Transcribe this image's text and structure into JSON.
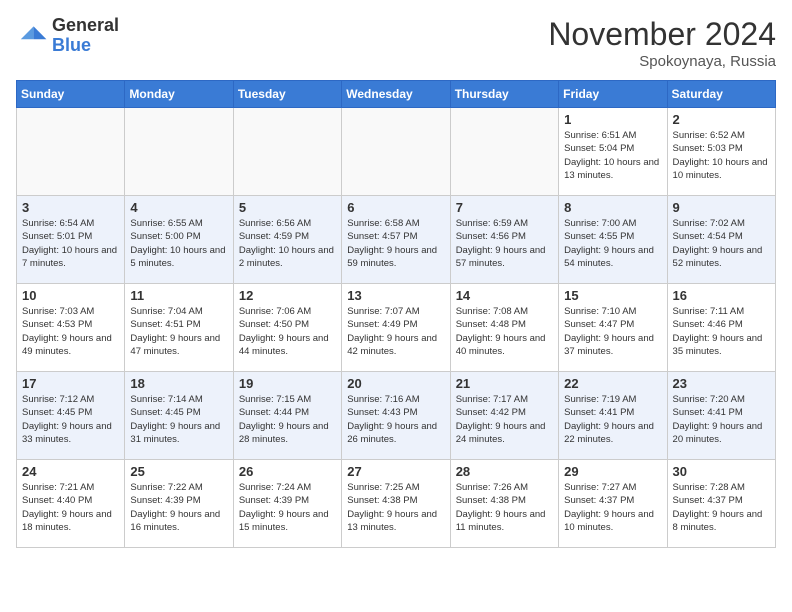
{
  "header": {
    "logo": {
      "line1": "General",
      "line2": "Blue"
    },
    "title": "November 2024",
    "subtitle": "Spokoynaya, Russia"
  },
  "weekdays": [
    "Sunday",
    "Monday",
    "Tuesday",
    "Wednesday",
    "Thursday",
    "Friday",
    "Saturday"
  ],
  "weeks": [
    [
      {
        "day": "",
        "info": ""
      },
      {
        "day": "",
        "info": ""
      },
      {
        "day": "",
        "info": ""
      },
      {
        "day": "",
        "info": ""
      },
      {
        "day": "",
        "info": ""
      },
      {
        "day": "1",
        "info": "Sunrise: 6:51 AM\nSunset: 5:04 PM\nDaylight: 10 hours\nand 13 minutes."
      },
      {
        "day": "2",
        "info": "Sunrise: 6:52 AM\nSunset: 5:03 PM\nDaylight: 10 hours\nand 10 minutes."
      }
    ],
    [
      {
        "day": "3",
        "info": "Sunrise: 6:54 AM\nSunset: 5:01 PM\nDaylight: 10 hours\nand 7 minutes."
      },
      {
        "day": "4",
        "info": "Sunrise: 6:55 AM\nSunset: 5:00 PM\nDaylight: 10 hours\nand 5 minutes."
      },
      {
        "day": "5",
        "info": "Sunrise: 6:56 AM\nSunset: 4:59 PM\nDaylight: 10 hours\nand 2 minutes."
      },
      {
        "day": "6",
        "info": "Sunrise: 6:58 AM\nSunset: 4:57 PM\nDaylight: 9 hours\nand 59 minutes."
      },
      {
        "day": "7",
        "info": "Sunrise: 6:59 AM\nSunset: 4:56 PM\nDaylight: 9 hours\nand 57 minutes."
      },
      {
        "day": "8",
        "info": "Sunrise: 7:00 AM\nSunset: 4:55 PM\nDaylight: 9 hours\nand 54 minutes."
      },
      {
        "day": "9",
        "info": "Sunrise: 7:02 AM\nSunset: 4:54 PM\nDaylight: 9 hours\nand 52 minutes."
      }
    ],
    [
      {
        "day": "10",
        "info": "Sunrise: 7:03 AM\nSunset: 4:53 PM\nDaylight: 9 hours\nand 49 minutes."
      },
      {
        "day": "11",
        "info": "Sunrise: 7:04 AM\nSunset: 4:51 PM\nDaylight: 9 hours\nand 47 minutes."
      },
      {
        "day": "12",
        "info": "Sunrise: 7:06 AM\nSunset: 4:50 PM\nDaylight: 9 hours\nand 44 minutes."
      },
      {
        "day": "13",
        "info": "Sunrise: 7:07 AM\nSunset: 4:49 PM\nDaylight: 9 hours\nand 42 minutes."
      },
      {
        "day": "14",
        "info": "Sunrise: 7:08 AM\nSunset: 4:48 PM\nDaylight: 9 hours\nand 40 minutes."
      },
      {
        "day": "15",
        "info": "Sunrise: 7:10 AM\nSunset: 4:47 PM\nDaylight: 9 hours\nand 37 minutes."
      },
      {
        "day": "16",
        "info": "Sunrise: 7:11 AM\nSunset: 4:46 PM\nDaylight: 9 hours\nand 35 minutes."
      }
    ],
    [
      {
        "day": "17",
        "info": "Sunrise: 7:12 AM\nSunset: 4:45 PM\nDaylight: 9 hours\nand 33 minutes."
      },
      {
        "day": "18",
        "info": "Sunrise: 7:14 AM\nSunset: 4:45 PM\nDaylight: 9 hours\nand 31 minutes."
      },
      {
        "day": "19",
        "info": "Sunrise: 7:15 AM\nSunset: 4:44 PM\nDaylight: 9 hours\nand 28 minutes."
      },
      {
        "day": "20",
        "info": "Sunrise: 7:16 AM\nSunset: 4:43 PM\nDaylight: 9 hours\nand 26 minutes."
      },
      {
        "day": "21",
        "info": "Sunrise: 7:17 AM\nSunset: 4:42 PM\nDaylight: 9 hours\nand 24 minutes."
      },
      {
        "day": "22",
        "info": "Sunrise: 7:19 AM\nSunset: 4:41 PM\nDaylight: 9 hours\nand 22 minutes."
      },
      {
        "day": "23",
        "info": "Sunrise: 7:20 AM\nSunset: 4:41 PM\nDaylight: 9 hours\nand 20 minutes."
      }
    ],
    [
      {
        "day": "24",
        "info": "Sunrise: 7:21 AM\nSunset: 4:40 PM\nDaylight: 9 hours\nand 18 minutes."
      },
      {
        "day": "25",
        "info": "Sunrise: 7:22 AM\nSunset: 4:39 PM\nDaylight: 9 hours\nand 16 minutes."
      },
      {
        "day": "26",
        "info": "Sunrise: 7:24 AM\nSunset: 4:39 PM\nDaylight: 9 hours\nand 15 minutes."
      },
      {
        "day": "27",
        "info": "Sunrise: 7:25 AM\nSunset: 4:38 PM\nDaylight: 9 hours\nand 13 minutes."
      },
      {
        "day": "28",
        "info": "Sunrise: 7:26 AM\nSunset: 4:38 PM\nDaylight: 9 hours\nand 11 minutes."
      },
      {
        "day": "29",
        "info": "Sunrise: 7:27 AM\nSunset: 4:37 PM\nDaylight: 9 hours\nand 10 minutes."
      },
      {
        "day": "30",
        "info": "Sunrise: 7:28 AM\nSunset: 4:37 PM\nDaylight: 9 hours\nand 8 minutes."
      }
    ]
  ]
}
